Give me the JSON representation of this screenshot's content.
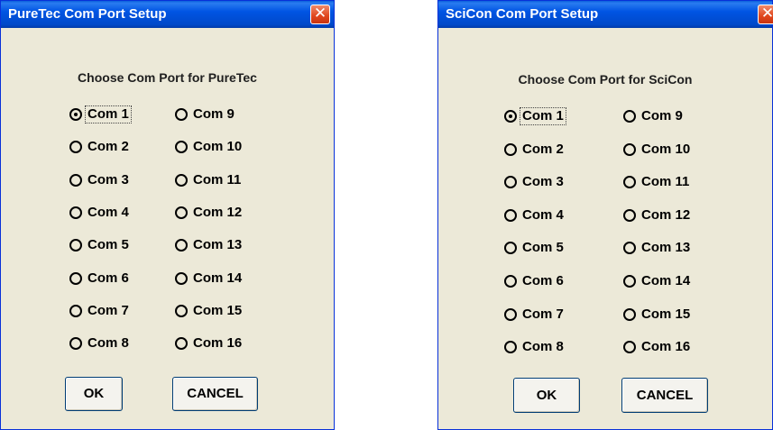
{
  "dialogs": [
    {
      "title": "PureTec Com Port Setup",
      "prompt": "Choose Com Port for PureTec",
      "close_glyph": "✕",
      "selected_port": "Com 1",
      "ports": [
        "Com 1",
        "Com 2",
        "Com 3",
        "Com 4",
        "Com 5",
        "Com 6",
        "Com 7",
        "Com 8",
        "Com 9",
        "Com 10",
        "Com 11",
        "Com 12",
        "Com 13",
        "Com 14",
        "Com 15",
        "Com 16"
      ],
      "ok_label": "OK",
      "cancel_label": "CANCEL"
    },
    {
      "title": "SciCon Com Port Setup",
      "prompt": "Choose Com Port for SciCon",
      "close_glyph": "✕",
      "selected_port": "Com 1",
      "ports": [
        "Com 1",
        "Com 2",
        "Com 3",
        "Com 4",
        "Com 5",
        "Com 6",
        "Com 7",
        "Com 8",
        "Com 9",
        "Com 10",
        "Com 11",
        "Com 12",
        "Com 13",
        "Com 14",
        "Com 15",
        "Com 16"
      ],
      "ok_label": "OK",
      "cancel_label": "CANCEL"
    }
  ],
  "colors": {
    "titlebar": "#0054e3",
    "dialog_bg": "#ece9d8",
    "close_button": "#e0461c"
  }
}
